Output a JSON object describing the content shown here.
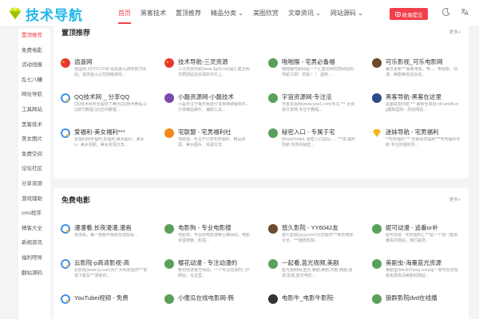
{
  "header": {
    "logo_text": "技术导航",
    "nav": [
      "首页",
      "黑客技术",
      "置顶推荐",
      "精品分类 ⌄",
      "美图欣赏",
      "文章资讯 ⌄",
      "网站源码 ⌄"
    ],
    "active_nav": 0,
    "submit_label": "收录提交"
  },
  "sidebar": {
    "items": [
      "置顶推荐",
      "免费电影",
      "活动线报",
      "乱七八糟",
      "网址导航",
      "工具网站",
      "黑客技术",
      "美女图片",
      "免费空间",
      "论坛社区",
      "分享资源",
      "游戏辅助",
      "cms程序",
      "搏客大全",
      "新闻资讯",
      "福利吧导",
      "翻站源码"
    ],
    "active": 0
  },
  "sections": [
    {
      "title": "置顶推荐",
      "more": "更多+",
      "items": [
        {
          "title": "逍遥网",
          "desc": "逍遥网 XOYO.COM 是由金山游戏官方网站，提供金山公司网络游戏...",
          "color": "#e8362b",
          "icon": "flag"
        },
        {
          "title": "技术导航-三灵资源",
          "desc": "三灵资源导航(www.3g30.net)是汇集全网优质网站及资源的中文上...",
          "color": "#e8362b",
          "icon": "flag"
        },
        {
          "title": "啪啪猴 - 宅男必备福",
          "desc": "啪啪猴导航网是一个汇集全网优质网站的导航工网！您提 ！！ 酒吧 ...",
          "color": "#5aa05a",
          "icon": "circle"
        },
        {
          "title": "可乐影视_可乐电影网",
          "desc": "每日更新***最新电影、电...，电视剧、动漫、美剧等高清在线...",
          "color": "#6b4c2a",
          "icon": "circle"
        },
        {
          "title": "QQ技术网 _ 分享QQ",
          "desc": "QQ技术网专业提供了腾讯QQ技术教程,QQ技巧教程,QQ空间教程...",
          "color": "#3a8ee6",
          "icon": "q"
        },
        {
          "title": "小磊资源网-小磊技术",
          "desc": "小磊专注于每天免费分享各种破解软件，分享精品娱乐，辅助工具...",
          "color": "#7a4ab0",
          "icon": "circle"
        },
        {
          "title": "宇宙资源网-专注活",
          "desc": "宇宙资源网(www.yzw1.com)专注 *** 太资源分享网,专注于教程,...",
          "color": "#5aa05a",
          "icon": "circle"
        },
        {
          "title": "黑客导航-黑客在这里",
          "desc": "黑客联盟导航 *** 最新全来自 nbl ann8t.org跟踪国际 - 原创网站...",
          "color": "#2a4a8a",
          "icon": "circle"
        },
        {
          "title": "爱福利-美女福利***",
          "desc": "爱福利网专福利,爱福利,美女图片，美女 n，美女视频，美女资源分享...",
          "color": "#3a8ee6",
          "icon": "q"
        },
        {
          "title": "宅联盟 - 宅男福利社",
          "desc": "宅联盟 - 专注于分享宅男福利、精品资源、美女图片、资源分享...",
          "color": "#f08a1c",
          "icon": "circle"
        },
        {
          "title": "秘密入口 - 专属于宅",
          "desc": "[RealyVodie]. 秘密入口是站...，***发,福利导航,宅男的秘密...",
          "color": "#5aa05a",
          "icon": "circle"
        },
        {
          "title": "迷妹导航 - 宅男福利",
          "desc": "**宅男福利 *** 你最喜欢福利***宅男福利导航-专注的福利导...",
          "color": "#f0b81c",
          "icon": "gem"
        }
      ]
    },
    {
      "title": "免费电影",
      "more": "更多+",
      "items": [
        {
          "title": "漫漫看,长夜漫漫,漫画",
          "desc": "漫漫看，每一部都可免费在线观看...",
          "color": "#3a8ee6",
          "icon": "q"
        },
        {
          "title": "电影狗 - 专业电影搜",
          "desc": "电影狗，专业的电影搜索引擎网站，电影资源搜索，影视...",
          "color": "#5aa05a",
          "icon": "circle"
        },
        {
          "title": "悠久影院 - YY6042友",
          "desc": "悠久影院(yyyy.com)为您提供***新的电影大全，***播放影院...",
          "color": "#6b4c2a",
          "icon": "circle"
        },
        {
          "title": "妮可动漫 - 追番or补",
          "desc": "妮可动漫 - 宅男福利汇***是一个零门槛追番看的网站，我们提供...",
          "color": "#5aa05a",
          "icon": "circle"
        },
        {
          "title": "云影院-p高清影视-高",
          "desc": "云影院(www.yy.com)为广大网友提供***影视下载及***更新的...",
          "color": "#3a8ee6",
          "icon": "q"
        },
        {
          "title": "樱花动漫 - 专注动漫的",
          "desc": "樱花动漫官方网站，一个专注动漫的门户网站，在这里...",
          "color": "#5aa05a",
          "icon": "circle"
        },
        {
          "title": "一起看,蓝光视频,美剧",
          "desc": "蓝光视频网,蓝光,美剧,美剧,日剧,韩剧,动漫,影视,蓝光电影...",
          "color": "#5aa05a",
          "icon": "circle"
        },
        {
          "title": "美剧虫-海量蓝光资源",
          "desc": "美剧虫(MeiJiChong.com)是一家可在线观看免费高清美剧的网站...",
          "color": "#5aa05a",
          "icon": "circle"
        },
        {
          "title": "YouTubei视频 - 免费",
          "desc": "",
          "color": "#3a8ee6",
          "icon": "q"
        },
        {
          "title": "小傻瓜在线电影网-韩",
          "desc": "",
          "color": "#5aa05a",
          "icon": "circle"
        },
        {
          "title": "电影牛_电影牛影院-",
          "desc": "",
          "color": "#333333",
          "icon": "circle"
        },
        {
          "title": "狼群影院dvd在线播",
          "desc": "",
          "color": "#5aa05a",
          "icon": "circle"
        }
      ]
    }
  ],
  "colors": {
    "accent": "#f1404b",
    "logo": "#21b7e8",
    "bg": "#f3f4f6"
  }
}
